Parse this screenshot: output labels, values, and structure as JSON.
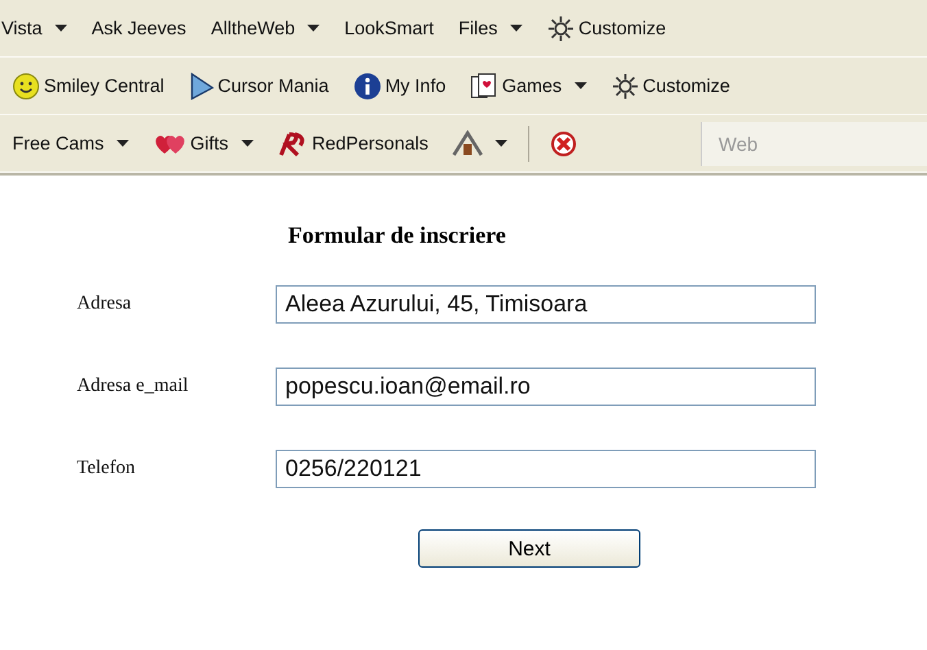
{
  "toolbars": [
    {
      "items": [
        {
          "label": "Vista",
          "dropdown": true
        },
        {
          "label": "Ask Jeeves",
          "dropdown": false
        },
        {
          "label": "AlltheWeb",
          "dropdown": true
        },
        {
          "label": "LookSmart",
          "dropdown": false
        },
        {
          "label": "Files",
          "dropdown": true
        },
        {
          "label": "Customize",
          "dropdown": false
        }
      ]
    },
    {
      "items": [
        {
          "label": "Smiley Central",
          "dropdown": false
        },
        {
          "label": "Cursor Mania",
          "dropdown": false
        },
        {
          "label": "My Info",
          "dropdown": false
        },
        {
          "label": "Games",
          "dropdown": true
        },
        {
          "label": "Customize",
          "dropdown": false
        }
      ]
    },
    {
      "items": [
        {
          "label": "Free Cams",
          "dropdown": true
        },
        {
          "label": "Gifts",
          "dropdown": true
        },
        {
          "label": "RedPersonals",
          "dropdown": false
        },
        {
          "dropdown": true
        }
      ],
      "search": {
        "placeholder": "Web"
      }
    }
  ],
  "form": {
    "title": "Formular de inscriere",
    "fields": [
      {
        "label": "Adresa",
        "value": "Aleea Azurului, 45, Timisoara"
      },
      {
        "label": "Adresa e_mail",
        "value": "popescu.ioan@email.ro"
      },
      {
        "label": "Telefon",
        "value": "0256/220121"
      }
    ],
    "button": "Next"
  }
}
